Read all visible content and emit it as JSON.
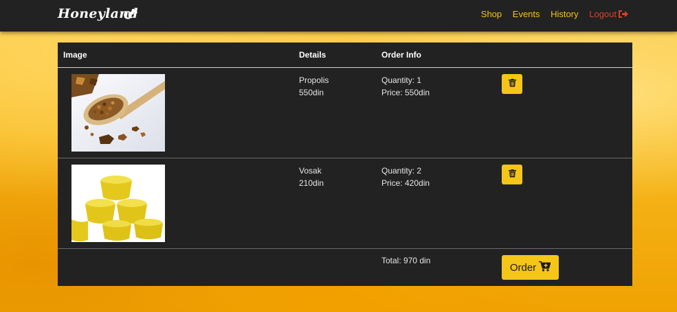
{
  "navbar": {
    "brand": "Honeyland",
    "links": {
      "shop": "Shop",
      "events": "Events",
      "history": "History",
      "logout": "Logout"
    }
  },
  "cart": {
    "headers": {
      "image": "Image",
      "details": "Details",
      "order_info": "Order Info"
    },
    "items": [
      {
        "name": "Propolis",
        "unit_price": "550din",
        "quantity": "Quantity: 1",
        "price": "Price: 550din"
      },
      {
        "name": "Vosak",
        "unit_price": "210din",
        "quantity": "Quantity: 2",
        "price": "Price: 420din"
      }
    ],
    "total": "Total: 970 din",
    "order_label": "Order"
  },
  "colors": {
    "accent": "#f5c518",
    "navbar_bg": "#222222",
    "logout": "#d9402b"
  }
}
